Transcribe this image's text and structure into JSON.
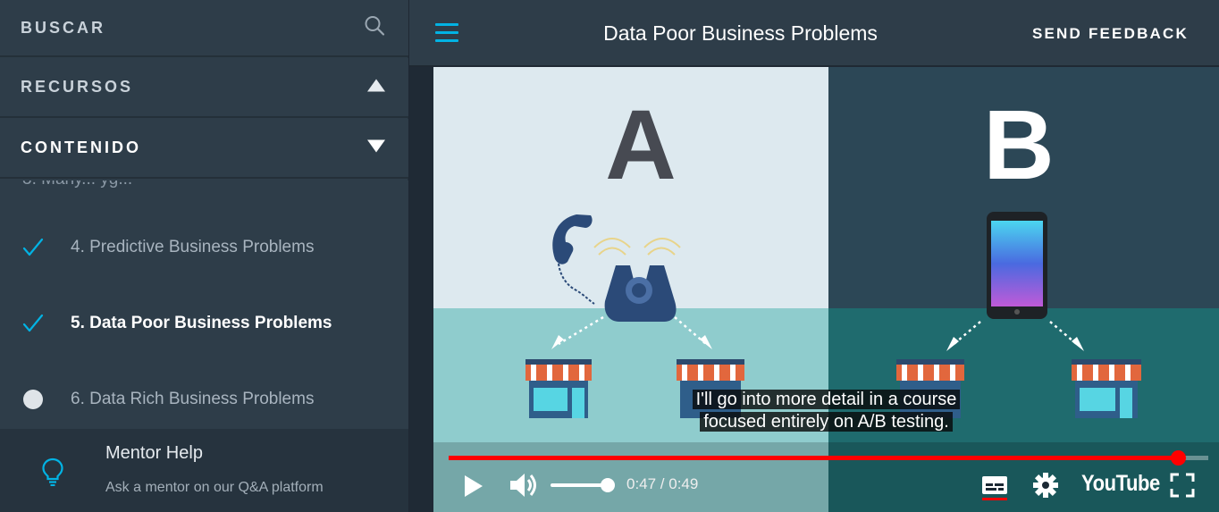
{
  "sidebar": {
    "search_label": "BUSCAR",
    "resources_label": "RECURSOS",
    "content_label": "CONTENIDO",
    "partial_lesson": "3. Many... yg...",
    "lessons": [
      {
        "label": "4. Predictive Business Problems",
        "status": "complete"
      },
      {
        "label": "5. Data Poor Business Problems",
        "status": "complete",
        "current": true
      },
      {
        "label": "6. Data Rich Business Problems",
        "status": "incomplete"
      }
    ],
    "mentor": {
      "title": "Mentor Help",
      "subtitle": "Ask a mentor on our Q&A platform"
    }
  },
  "header": {
    "title": "Data Poor Business Problems",
    "feedback_label": "SEND FEEDBACK"
  },
  "video": {
    "panel_a_label": "A",
    "panel_b_label": "B",
    "caption_line1": "I'll go into more detail in a course",
    "caption_line2": "focused entirely on A/B testing.",
    "time_display": "0:47 / 0:49",
    "progress_fraction": 0.96,
    "volume_fraction": 1.0,
    "brand": "YouTube"
  },
  "colors": {
    "accent": "#02b3e4",
    "sidebar_bg": "#2e3d49",
    "progress": "#ff0000",
    "check": "#02b3e4"
  }
}
